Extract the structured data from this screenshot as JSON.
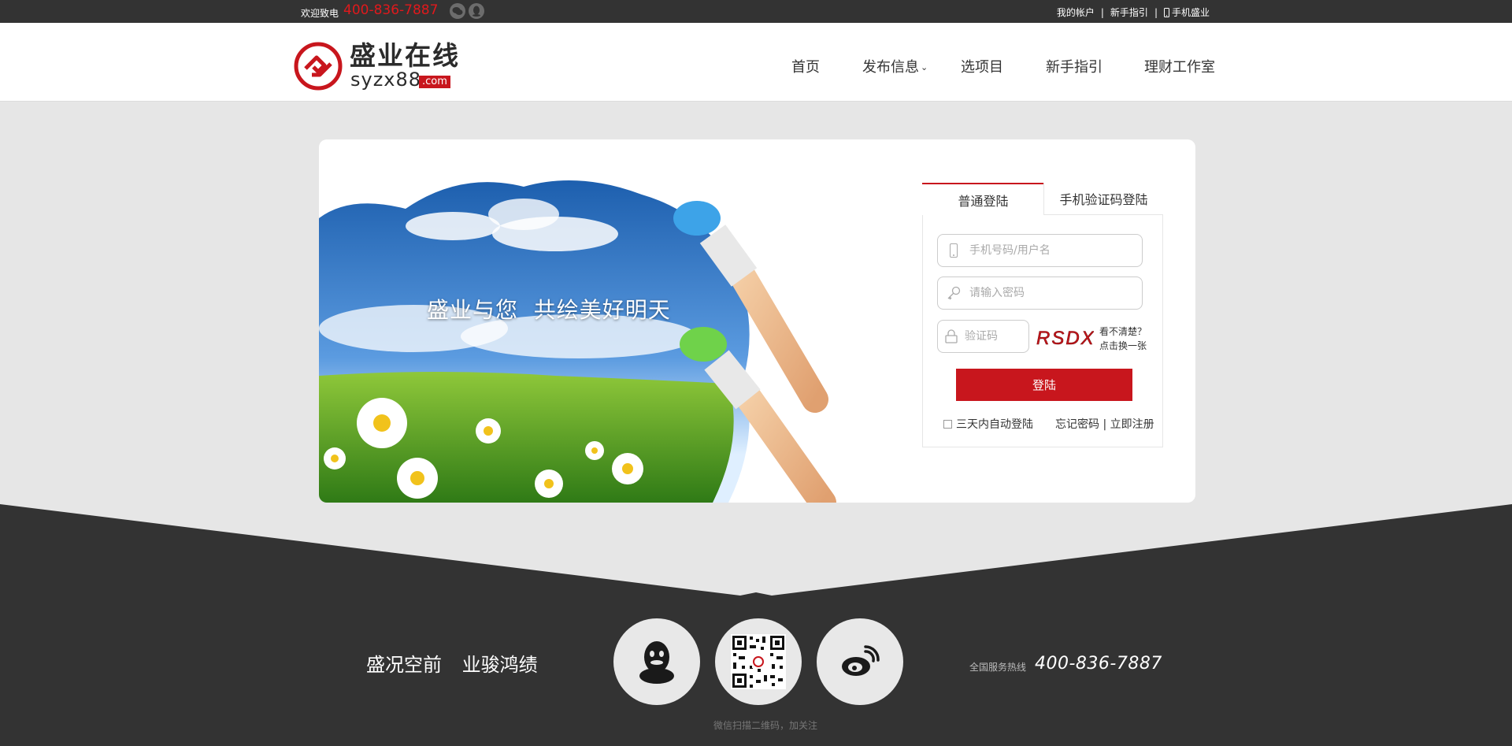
{
  "topbar": {
    "welcome": "欢迎致电",
    "hotline": "400-836-7887",
    "social_icons": [
      "wechat-icon",
      "qq-icon"
    ],
    "links": {
      "account": "我的帐户",
      "sep1": "|",
      "guide": "新手指引",
      "sep2": "|",
      "mobile": "手机盛业"
    }
  },
  "header": {
    "logo": {
      "cn": "盛业在线",
      "en": "syzx88",
      "dotcom": ".com"
    },
    "nav": [
      {
        "label": "首页"
      },
      {
        "label": "发布信息",
        "caret": "⌄"
      },
      {
        "label": "选项目"
      },
      {
        "label": "新手指引"
      },
      {
        "label": "理财工作室"
      }
    ]
  },
  "banner": {
    "text": "盛业与您  共绘美好明天"
  },
  "login": {
    "tabs": [
      "普通登陆",
      "手机验证码登陆"
    ],
    "active_tab": 0,
    "username_placeholder": "手机号码/用户名",
    "password_placeholder": "请输入密码",
    "captcha_placeholder": "验证码",
    "captcha_text": "RSDX",
    "refresh_line1": "看不清楚？",
    "refresh_line2": "点击换一张",
    "submit": "登陆",
    "remember": "三天内自动登陆",
    "forgot": "忘记密码",
    "sep": "|",
    "register": "立即注册",
    "accent_color": "#c8161d"
  },
  "footer": {
    "slogan": "盛况空前 业骏鸿绩",
    "qr_caption": "微信扫描二维码，加关注",
    "service_label": "全国服务热线",
    "service_phone": "400-836-7887",
    "icons": [
      "qq-icon",
      "qr-code",
      "weibo-icon"
    ]
  }
}
